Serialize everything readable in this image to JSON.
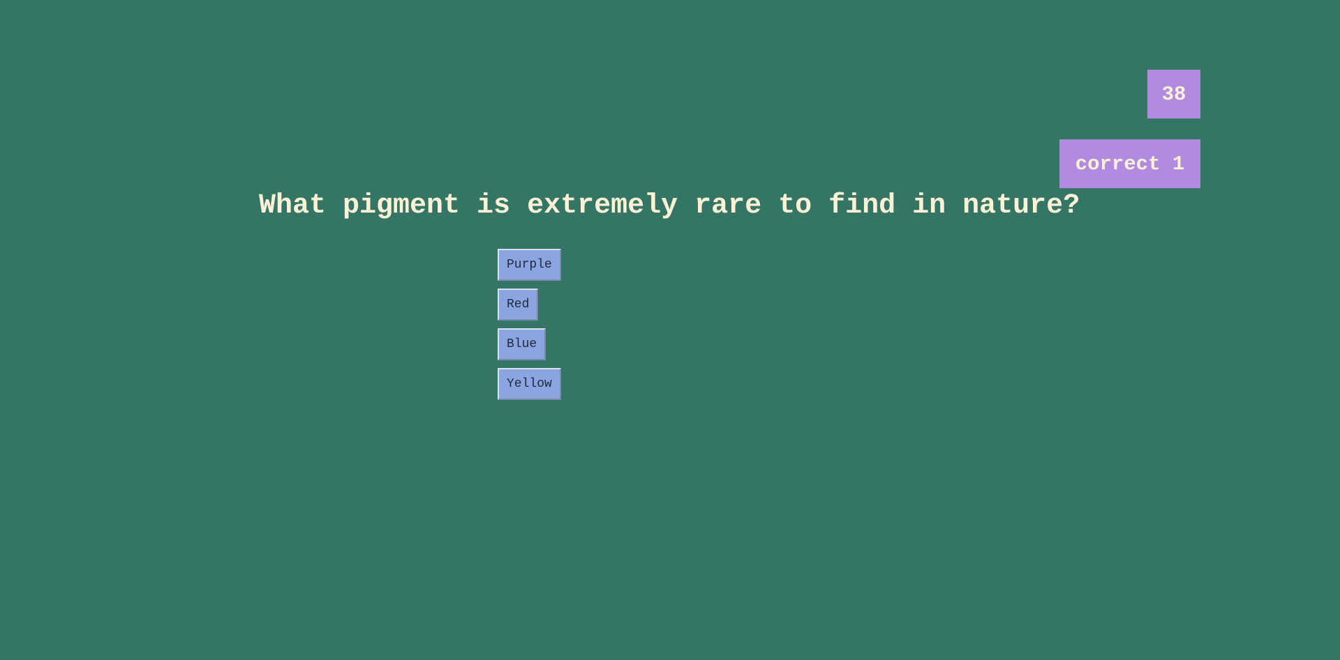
{
  "timer": {
    "value": "38"
  },
  "score": {
    "label": "correct 1"
  },
  "question": {
    "text": "What pigment is extremely rare to find in nature?"
  },
  "answers": [
    {
      "label": "Purple"
    },
    {
      "label": "Red"
    },
    {
      "label": "Blue"
    },
    {
      "label": "Yellow"
    }
  ],
  "colors": {
    "background": "#347565",
    "badge": "#b08be0",
    "text": "#fdf2d5",
    "button": "#8ba5e0"
  }
}
